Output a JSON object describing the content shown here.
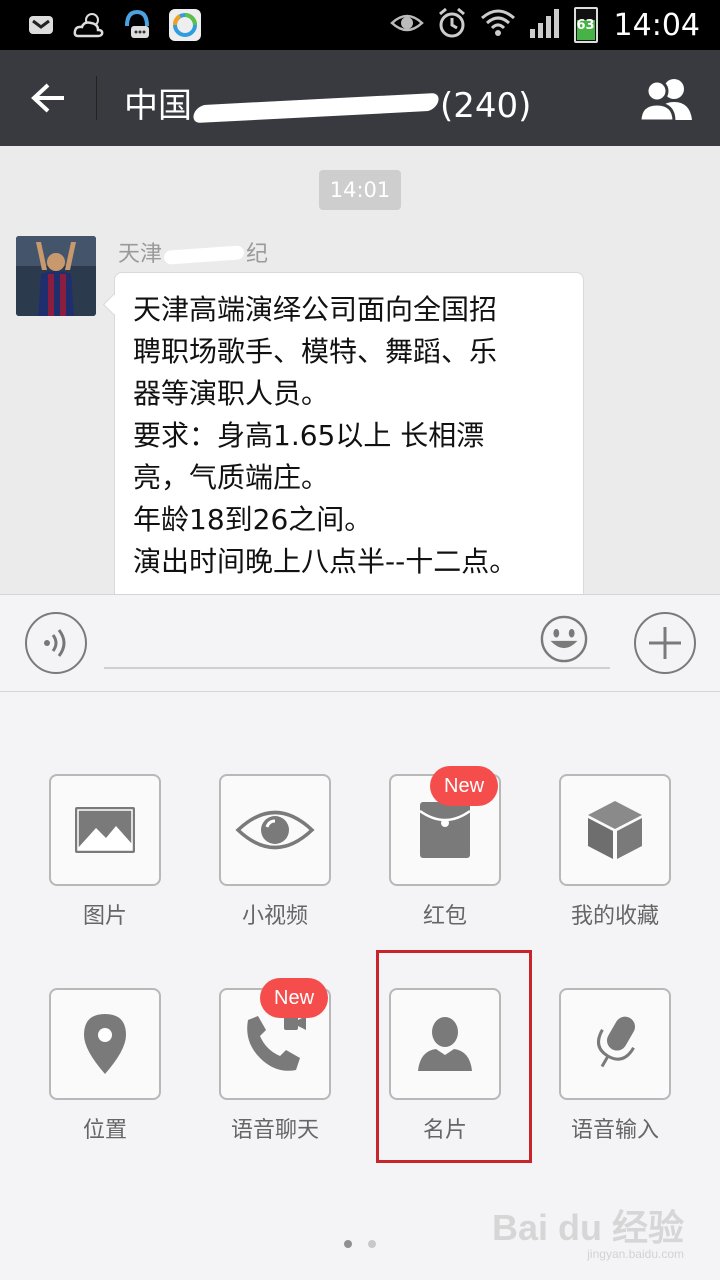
{
  "status_bar": {
    "time": "14:04",
    "battery": "63",
    "icons": [
      "mail-icon",
      "weather-icon",
      "chat-app-icon",
      "browser-app-icon",
      "eye-icon",
      "alarm-icon",
      "wifi-icon",
      "signal-icon",
      "battery-icon"
    ]
  },
  "header": {
    "title_visible_prefix": "中国",
    "title_visible_suffix": "(240)",
    "back_icon": "back-arrow-icon",
    "group_icon": "group-members-icon",
    "bar_color": "#393a3f"
  },
  "chat": {
    "timestamp": "14:01",
    "sender_prefix": "天津",
    "sender_suffix": "纪",
    "message_lines": [
      "天津高端演绎公司面向全国招",
      "聘职场歌手、模特、舞蹈、乐",
      "器等演职人员。",
      "要求：身高1.65以上 长相漂",
      "亮，气质端庄。",
      "年龄18到26之间。",
      "演出时间晚上八点半--十二点。"
    ]
  },
  "input_bar": {
    "voice_icon": "voice-icon",
    "emoji_icon": "emoji-icon",
    "plus_icon": "plus-icon",
    "text_value": ""
  },
  "panel": {
    "items": [
      {
        "label": "图片",
        "icon": "image-icon",
        "badge": ""
      },
      {
        "label": "小视频",
        "icon": "eye-video-icon",
        "badge": ""
      },
      {
        "label": "红包",
        "icon": "red-packet-icon",
        "badge": "New"
      },
      {
        "label": "我的收藏",
        "icon": "favorites-cube-icon",
        "badge": ""
      },
      {
        "label": "位置",
        "icon": "location-pin-icon",
        "badge": ""
      },
      {
        "label": "语音聊天",
        "icon": "voice-call-icon",
        "badge": "New"
      },
      {
        "label": "名片",
        "icon": "contact-card-icon",
        "badge": ""
      },
      {
        "label": "语音输入",
        "icon": "microphone-icon",
        "badge": ""
      }
    ],
    "highlighted_item": "名片",
    "highlight_color": "#c8242c",
    "badge_color": "#f54c4c",
    "page": 1,
    "page_count": 2
  },
  "watermark": {
    "brand": "Bai du 经验",
    "url": "jingyan.baidu.com"
  }
}
